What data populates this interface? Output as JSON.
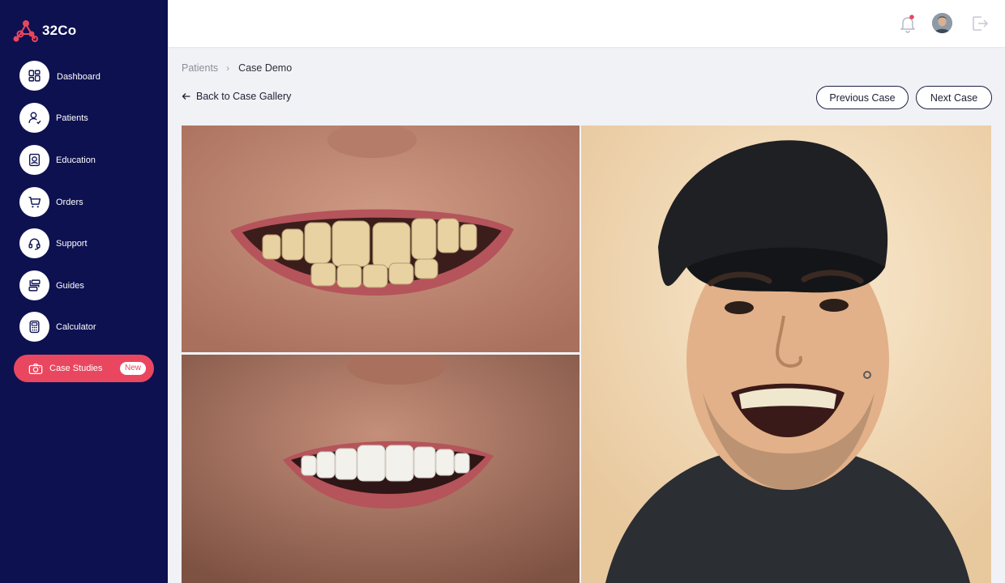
{
  "brand": {
    "name": "32Co",
    "accent": "#e9475f",
    "sidebar_bg": "#0d1150"
  },
  "sidebar": {
    "items": [
      {
        "label": "Dashboard",
        "icon": "dashboard-icon"
      },
      {
        "label": "Patients",
        "icon": "patients-icon"
      },
      {
        "label": "Education",
        "icon": "education-icon"
      },
      {
        "label": "Orders",
        "icon": "cart-icon"
      },
      {
        "label": "Support",
        "icon": "headset-icon"
      },
      {
        "label": "Guides",
        "icon": "guides-icon"
      },
      {
        "label": "Calculator",
        "icon": "calculator-icon"
      }
    ],
    "active_item": {
      "label": "Case Studies",
      "icon": "camera-icon",
      "badge": "New"
    }
  },
  "header": {
    "icons": [
      "bell-icon",
      "avatar",
      "logout-icon"
    ],
    "notification_dot_color": "#e9475f"
  },
  "breadcrumb": {
    "parent": "Patients",
    "current": "Case Demo"
  },
  "actions": {
    "back_label": "Back to Case Gallery",
    "previous_label": "Previous Case",
    "next_label": "Next Case"
  },
  "photos": [
    {
      "name": "before-smile-closeup"
    },
    {
      "name": "after-smile-closeup"
    },
    {
      "name": "patient-portrait"
    }
  ]
}
